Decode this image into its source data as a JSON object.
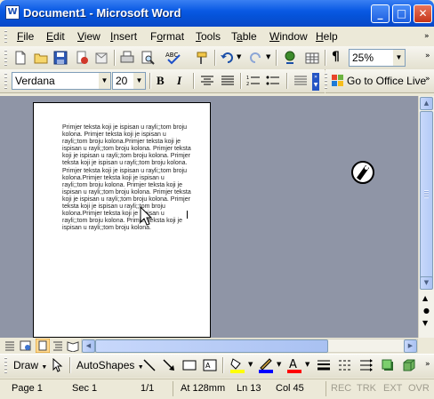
{
  "window": {
    "title": "Document1 - Microsoft Word"
  },
  "menu": [
    "File",
    "Edit",
    "View",
    "Insert",
    "Format",
    "Tools",
    "Table",
    "Window",
    "Help"
  ],
  "menu_access": [
    "F",
    "E",
    "V",
    "I",
    "o",
    "T",
    "a",
    "W",
    "H"
  ],
  "standard_toolbar": {
    "zoom": "25%"
  },
  "formatting_toolbar": {
    "font": "Verdana",
    "size": "20",
    "bold": "B",
    "italic": "I",
    "office_live": "Go to Office Live"
  },
  "document": {
    "text": "Primjer teksta koji je ispisan u rayli;;tom broju kolona. Primjer teksta koji je ispisan u rayli;;tom broju kolona.Primjer teksta koji je ispisan u rayli;;tom broju kolona. Primjer teksta koji je ispisan u rayli;;tom broju kolona. Primjer teksta koji je ispisan u rayli;;tom broju kolona. Primjer teksta koji je ispisan u rayli;;tom broju kolona.Primjer teksta koji je ispisan u rayli;;tom broju kolona. Primjer teksta koji je ispisan u rayli;;tom broju kolona. Primjer teksta koji je ispisan u rayli;;tom broju kolona. Primjer teksta koji je ispisan u rayli;;tom broju kolona.Primjer teksta koji je ispisan u rayli;;tom broju kolona. Primjer teksta koji je ispisan u rayli;;tom broju kolona."
  },
  "drawing_toolbar": {
    "draw": "Draw",
    "autoshapes": "AutoShapes"
  },
  "status": {
    "page": "Page 1",
    "sec": "Sec 1",
    "of": "1/1",
    "at": "At 128mm",
    "ln": "Ln 13",
    "col": "Col 45",
    "rec": "REC",
    "trk": "TRK",
    "ext": "EXT",
    "ovr": "OVR"
  },
  "colors": {
    "titlebar": "#0a5ae4",
    "workspace": "#8f95a6",
    "highlight": "#ffff00",
    "font_color": "#ff0000",
    "line_color": "#0000ff"
  }
}
